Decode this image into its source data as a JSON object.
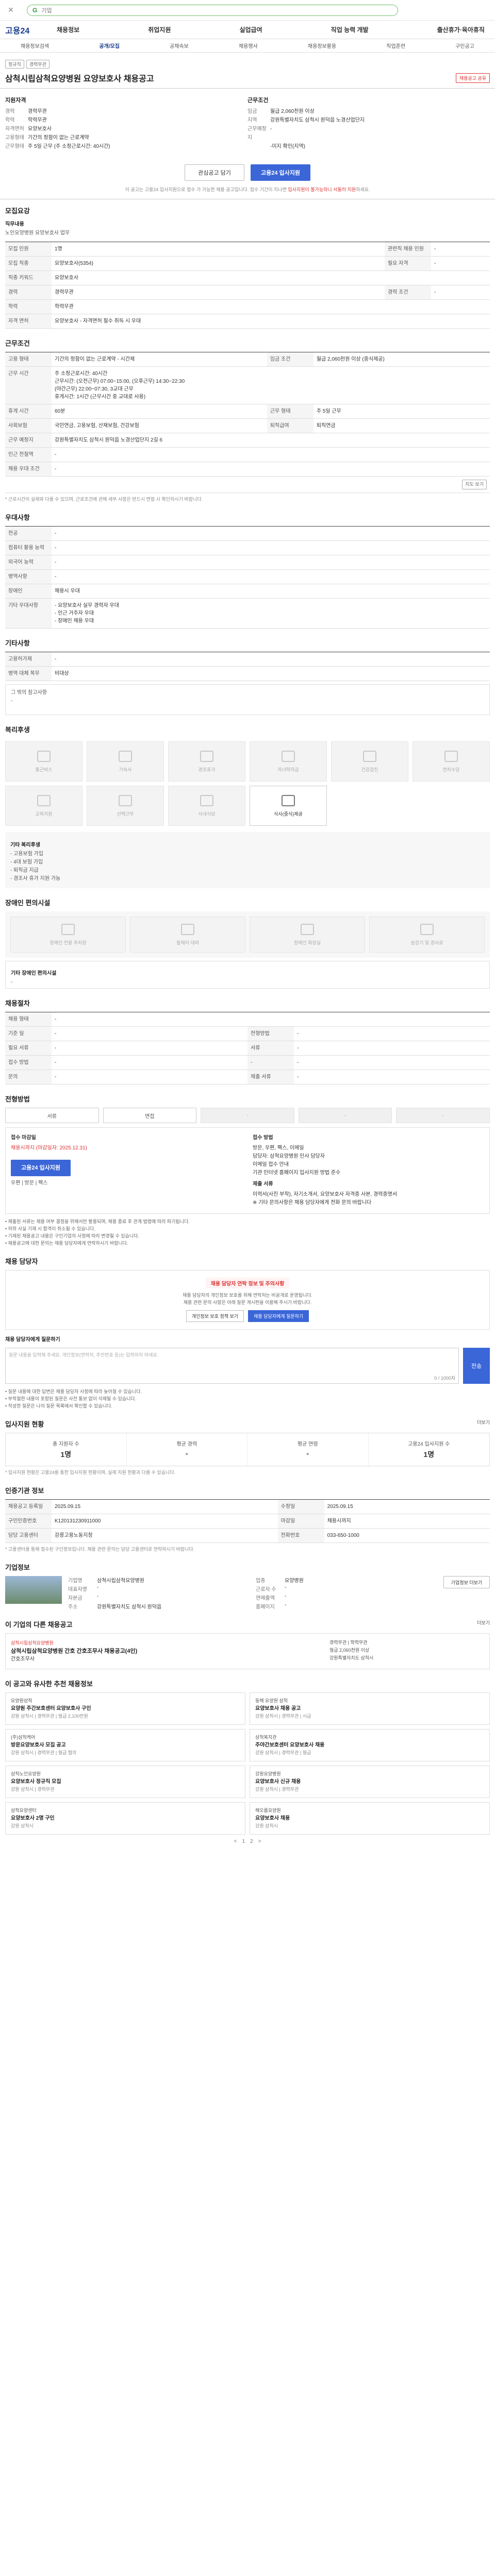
{
  "browser": {
    "search_brand": "G",
    "search_text": "기업"
  },
  "site": {
    "logo": "고용24",
    "nav": [
      "채용정보",
      "취업지원",
      "실업급여",
      "직업 능력 개발",
      "출산휴가·육아휴직"
    ],
    "subnav": [
      "채용정보검색",
      "공개/모집",
      "공채속보",
      "채용행사",
      "채용정보활용",
      "직업훈련",
      "구인공고"
    ],
    "subnav_active": 1
  },
  "job": {
    "tags": [
      "정규직",
      "경력무관"
    ],
    "title": "삼척시립삼척요양병원 요양보호사 채용공고",
    "share": "채용공고 공유",
    "left_heading": "지원자격",
    "left": [
      {
        "k": "경력",
        "v": "경력무관"
      },
      {
        "k": "학력",
        "v": "학력무관"
      },
      {
        "k": "자격면허",
        "v": "요양보호사"
      },
      {
        "k": "고용형태",
        "v": "기간의 정함이 없는 근로계약"
      },
      {
        "k": "근무형태",
        "v": "주 5일 근무 (주 소정근로시간: 40시간)"
      }
    ],
    "right_heading": "근무조건",
    "right": [
      {
        "k": "임금",
        "v": "월급 2,060천원 이상"
      },
      {
        "k": "지역",
        "v": "강원특별자치도 삼척시 원덕읍 노경산업단지"
      },
      {
        "k": "근무예정지",
        "v": "-"
      },
      {
        "k": "",
        "v": "-미지 확인(지역)"
      }
    ],
    "interest_btn": "관심공고 담기",
    "apply_btn": "고용24 입사지원",
    "notice": "이 공고는 고용24 입사지원으로 접수 가 가능한 채용 공고입니다. 접수 기간이 지나면 ",
    "notice_red": "입사지원이 불가능하니 서둘러 지원",
    "notice_tail": "하세요."
  },
  "recruit": {
    "title": "모집요강",
    "duty_label": "직무내용",
    "duty_text": "노인요양병원 요양보호사 업무",
    "rows": [
      {
        "k": "모집 인원",
        "v": "1명",
        "k2": "관련직 채용 인원",
        "v2": "-"
      },
      {
        "k": "모집 직종",
        "v": "요양보호사(5354)",
        "k2": "필요 자격",
        "v2": "-"
      },
      {
        "k": "직종 키워드",
        "v": "요양보호사",
        "k2": "",
        "v2": ""
      },
      {
        "k": "경력",
        "v": "경력무관",
        "k2": "경력 조건",
        "v2": "-"
      },
      {
        "k": "학력",
        "v": "학력무관",
        "k2": "",
        "v2": ""
      },
      {
        "k": "자격 면허",
        "v": "요양보호사  - 자격면허 필수 취득 시 우대",
        "k2": "",
        "v2": ""
      }
    ]
  },
  "conditions": {
    "title": "근무조건",
    "rows": [
      {
        "k": "고용 형태",
        "v": "기간의 정함이 없는 근로계약 - 시간제",
        "k2": "임금 조건",
        "v2": "월급 2,060천원 이상 (중식제공)"
      },
      {
        "k": "근무 시간",
        "v": "주 소정근로시간: 40시간\n근무시간: (오전근무) 07:00~15:00, (오후근무) 14:30~22:30\n(야간근무) 22:00~07:30, 3교대 근무\n휴게시간: 1시간 (근무시간 중 교대로 사용)",
        "k2": "",
        "v2": ""
      },
      {
        "k": "휴게 시간",
        "v": "60분",
        "k2": "근무 형태",
        "v2": "주 5일 근무"
      },
      {
        "k": "사회보험",
        "v": "국민연금, 고용보험, 산재보험, 건강보험",
        "k2": "퇴직급여",
        "v2": "퇴직연금"
      },
      {
        "k": "근무 예정지",
        "v": "강원특별자치도 삼척시 원덕읍 노경산업단지 2길 6",
        "k2": "",
        "v2": ""
      },
      {
        "k": "인근 전철역",
        "v": "-",
        "k2": "",
        "v2": ""
      },
      {
        "k": "채용 우대 조건",
        "v": "-",
        "k2": "",
        "v2": ""
      }
    ],
    "map_btn": "지도 보기",
    "note": "* 근로시간이 실제와 다를 수 있으며, 근로조건에 관해 세부 사항은 반드시 면접 시 확인하시기 바랍니다."
  },
  "preference": {
    "title": "우대사항",
    "rows": [
      {
        "k": "전공",
        "v": "-"
      },
      {
        "k": "컴퓨터 활용 능력",
        "v": "-"
      },
      {
        "k": "외국어 능력",
        "v": "-"
      },
      {
        "k": "병역사항",
        "v": "-"
      },
      {
        "k": "장애인",
        "v": "채용시 우대"
      },
      {
        "k": "기타 우대사항",
        "v": "- 요양보호사 실무 경력자 우대\n- 인근 거주자 우대\n- 장애인 채용 우대"
      }
    ]
  },
  "etc": {
    "title": "기타사항",
    "rows": [
      {
        "k": "고용허가제",
        "v": "-"
      },
      {
        "k": "병역 대체 복무",
        "v": "비대상"
      }
    ],
    "box": "그 밖의 참고사항\n-"
  },
  "welfare": {
    "title": "복리후생",
    "tiles": [
      "통근버스",
      "기숙사",
      "경조휴가",
      "자녀학자금",
      "건강검진",
      "연차수당",
      "교육지원",
      "선택근무",
      "사내식당",
      "식사(중식)제공"
    ],
    "active": [
      9
    ],
    "box_title": "기타 복리후생",
    "box_items": [
      "- 고용보험 가입",
      "- 4대 보험 가입",
      "- 퇴직금 지급",
      "- 경조사 휴가 지원 가능"
    ]
  },
  "disability": {
    "title": "장애인 편의시설",
    "tiles": [
      "장애인 전용 주차장",
      "휠체어 대여",
      "장애인 화장실",
      "승강기 및 경사로"
    ],
    "box_title": "기타 장애인 편의시설",
    "box_text": "-"
  },
  "process": {
    "title": "채용절차",
    "rows": [
      {
        "k": "채용 형태",
        "v": "-",
        "k2": "",
        "v2": ""
      },
      {
        "k": "기준 일",
        "v": "-",
        "k2": "전형방법",
        "v2": "-"
      },
      {
        "k": "필요 서류",
        "v": "-",
        "k2": "서류",
        "v2": "-"
      },
      {
        "k": "접수 방법",
        "v": "-",
        "k2": "-",
        "v2": "-"
      },
      {
        "k": "문의",
        "v": "-",
        "k2": "제출 서류",
        "v2": "-"
      }
    ]
  },
  "apply": {
    "title": "전형방법",
    "steps": [
      {
        "label": "서류",
        "dim": false
      },
      {
        "label": "면접",
        "dim": false
      },
      {
        "label": "-",
        "dim": true
      },
      {
        "label": "-",
        "dim": true
      },
      {
        "label": "-",
        "dim": true
      }
    ],
    "left_title": "접수 마감일",
    "left_lines": [
      "채용시까지 (마감일자: 2025.12.31)"
    ],
    "left_btn": "고용24 입사지원",
    "left_link": "우편 | 방문 | 팩스",
    "right_title": "접수 방법",
    "right_lines": [
      "방문, 우편, 팩스, 이메일",
      "담당자: 삼척요양병원 인사 담당자",
      "이메일 접수 안내",
      "기관 인터넷 홈페이지 입사지원 방법 준수"
    ],
    "right_sub": "제출 서류",
    "right_sub_lines": [
      "이력서(사진 부착), 자기소개서, 요양보호사 자격증 사본, 경력증명서",
      "※ 기타 문의사항은 채용 담당자에게 전화 문의 바랍니다"
    ],
    "bullets": [
      "• 제출된 서류는 채용 여부 결정을 위해서만 활용되며, 채용 종료 후 관계 법령에 따라 파기됩니다.",
      "• 허위 사실 기재 시 합격이 취소될 수 있습니다.",
      "• 기재된 채용공고 내용은 구인기업의 사정에 따라 변경될 수 있습니다.",
      "• 채용공고에 대한 문의는 채용 담당자에게 연락하시기 바랍니다."
    ]
  },
  "qa": {
    "title": "채용 담당자",
    "warn": "채용 담당자 연락 정보 및 주의사항",
    "desc": "채용 담당자의 개인정보 보호를 위해 연락처는 비공개로 운영됩니다.\n채용 관련 문의 사항은 아래 질문 게시판을 이용해 주시기 바랍니다.",
    "btn1": "개인정보 보호 정책 보기",
    "btn2": "채용 담당자에게 질문하기",
    "form_title": "채용 담당자에게 질문하기",
    "placeholder": "질문 내용을 입력해 주세요. 개인정보(연락처, 주민번호 등)는 입력하지 마세요.",
    "counter": "0 / 1000자",
    "send": "전송",
    "notes": [
      "• 질문 내용에 대한 답변은 채용 담당자 사정에 따라 늦어질 수 있습니다.",
      "• 부적절한 내용이 포함된 질문은 사전 통보 없이 삭제될 수 있습니다.",
      "• 작성한 질문은 나의 질문 목록에서 확인할 수 있습니다."
    ]
  },
  "stats": {
    "title": "입사지원 현황",
    "more": "더보기",
    "items": [
      {
        "label": "총 지원자 수",
        "value": "1명"
      },
      {
        "label": "평균 경력",
        "value": "-"
      },
      {
        "label": "평균 연령",
        "value": "-"
      },
      {
        "label": "고용24 입사지원 수",
        "value": "1명"
      }
    ],
    "note": "* 입사지원 현황은 고용24를 통한 입사지원 현황이며, 실제 지원 현황과 다를 수 있습니다."
  },
  "agency": {
    "title": "인증기관 정보",
    "rows": [
      {
        "k": "채용공고 등록일",
        "v": "2025.09.15",
        "k2": "수정일",
        "v2": "2025.09.15"
      },
      {
        "k": "구인인증번호",
        "v": "K120131230911000",
        "k2": "마감일",
        "v2": "채용시까지"
      },
      {
        "k": "담당 고용센터",
        "v": "강릉고용노동지청",
        "k2": "전화번호",
        "v2": "033-650-1000"
      }
    ],
    "note": "* 고용센터를 통해 접수된 구인정보입니다. 채용 관련 문의는 담당 고용센터로 연락하시기 바랍니다."
  },
  "company": {
    "title": "기업정보",
    "rows": [
      {
        "k": "기업명",
        "v": "삼척시립삼척요양병원"
      },
      {
        "k": "업종",
        "v": "요양병원"
      },
      {
        "k": "대표자명",
        "v": "-"
      },
      {
        "k": "근로자 수",
        "v": "-"
      },
      {
        "k": "자본금",
        "v": "-"
      },
      {
        "k": "연매출액",
        "v": "-"
      },
      {
        "k": "주소",
        "v": "강원특별자치도 삼척시 원덕읍"
      },
      {
        "k": "홈페이지",
        "v": "-"
      }
    ],
    "btn": "기업정보 더보기"
  },
  "similar": {
    "title": "이 기업의 다른 채용공고",
    "more": "더보기",
    "org": "삼척시립삼척요양병원",
    "job": "삼척시립삼척요양병원 간호 간호조무사 채용공고(4인)",
    "sub": "간호조무사",
    "info": [
      "경력무관 | 학력무관",
      "월급 2,060천원 이상",
      "강원특별자치도 삼척시"
    ]
  },
  "recommend": {
    "title": "이 공고와 유사한 추천 채용정보",
    "cards": [
      {
        "corp": "요양원삼척",
        "title": "요양원 주간보호센터 요양보호사 구인",
        "meta": "강원 삼척시 | 경력무관 | 월급 2,100만원"
      },
      {
        "corp": "동해 요양원 삼척",
        "title": "요양보호사 채용 공고",
        "meta": "강원 삼척시 | 경력무관 | 시급"
      },
      {
        "corp": "(주)삼척케어",
        "title": "방문요양보호사 모집 공고",
        "meta": "강원 삼척시 | 경력무관 | 월급 협의"
      },
      {
        "corp": "삼척복지관",
        "title": "주야간보호센터 요양보호사 채용",
        "meta": "강원 삼척시 | 경력무관 | 월급"
      },
      {
        "corp": "삼척노인요양원",
        "title": "요양보호사 정규직 모집",
        "meta": "강원 삼척시 | 경력무관"
      },
      {
        "corp": "강원요양병원",
        "title": "요양보호사 신규 채용",
        "meta": "강원 삼척시 | 경력무관"
      },
      {
        "corp": "삼척요양센터",
        "title": "요양보호사 2명 구인",
        "meta": "강원 삼척시"
      },
      {
        "corp": "해오름요양원",
        "title": "요양보호사 채용",
        "meta": "강원 삼척시"
      }
    ],
    "pager": [
      "<",
      "1",
      "2",
      ">"
    ]
  }
}
